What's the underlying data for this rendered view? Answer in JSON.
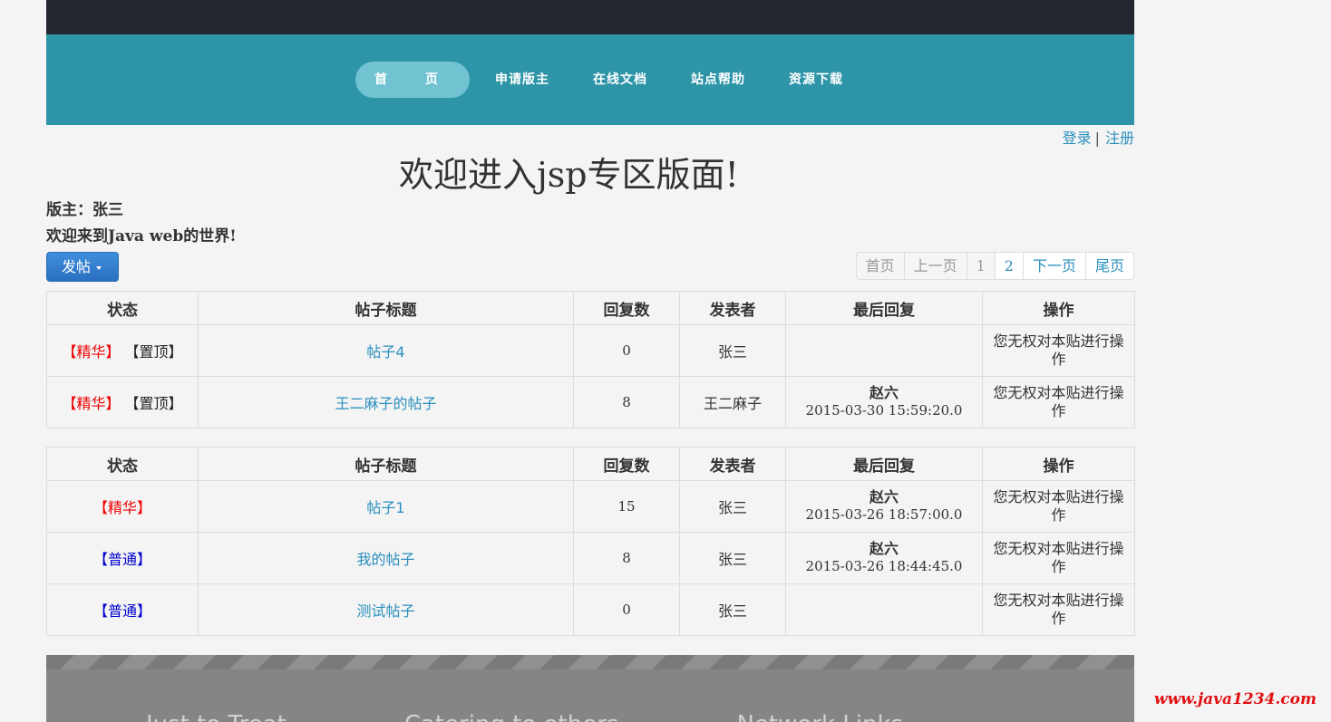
{
  "nav": {
    "items": [
      "首　页",
      "申请版主",
      "在线文档",
      "站点帮助",
      "资源下载"
    ]
  },
  "auth": {
    "login": "登录",
    "separator": "|",
    "register": "注册"
  },
  "page_title": "欢迎进入jsp专区版面!",
  "moderator_line": "版主：张三",
  "welcome_line": "欢迎来到Java web的世界!",
  "post_button": "发帖",
  "pager": {
    "first": "首页",
    "prev": "上一页",
    "page1": "1",
    "page2": "2",
    "next": "下一页",
    "last": "尾页"
  },
  "table_headers": [
    "状态",
    "帖子标题",
    "回复数",
    "发表者",
    "最后回复",
    "操作"
  ],
  "pinned_posts": [
    {
      "tag1": "【精华】",
      "tag2": "【置顶】",
      "title": "帖子4",
      "replies": "0",
      "author": "张三",
      "last_user": "",
      "last_time": "",
      "ops": "您无权对本贴进行操作"
    },
    {
      "tag1": "【精华】",
      "tag2": "【置顶】",
      "title": "王二麻子的帖子",
      "replies": "8",
      "author": "王二麻子",
      "last_user": "赵六",
      "last_time": "2015-03-30 15:59:20.0",
      "ops": "您无权对本贴进行操作"
    }
  ],
  "normal_posts": [
    {
      "tag": "【精华】",
      "tag_type": "jh",
      "title": "帖子1",
      "replies": "15",
      "author": "张三",
      "last_user": "赵六",
      "last_time": "2015-03-26 18:57:00.0",
      "ops": "您无权对本贴进行操作"
    },
    {
      "tag": "【普通】",
      "tag_type": "pt",
      "title": "我的帖子",
      "replies": "8",
      "author": "张三",
      "last_user": "赵六",
      "last_time": "2015-03-26 18:44:45.0",
      "ops": "您无权对本贴进行操作"
    },
    {
      "tag": "【普通】",
      "tag_type": "pt",
      "title": "测试帖子",
      "replies": "0",
      "author": "张三",
      "last_user": "",
      "last_time": "",
      "ops": "您无权对本贴进行操作"
    }
  ],
  "footer_links": [
    "Just to Treat",
    "Catering to others",
    "Network Links"
  ],
  "watermark": "www.java1234.com",
  "colors": {
    "nav_bg": "#2e95a8",
    "topbar_bg": "#23262f",
    "link": "#2a8fbd",
    "essence_tag": "#e00000",
    "normal_tag": "#0000cc"
  }
}
